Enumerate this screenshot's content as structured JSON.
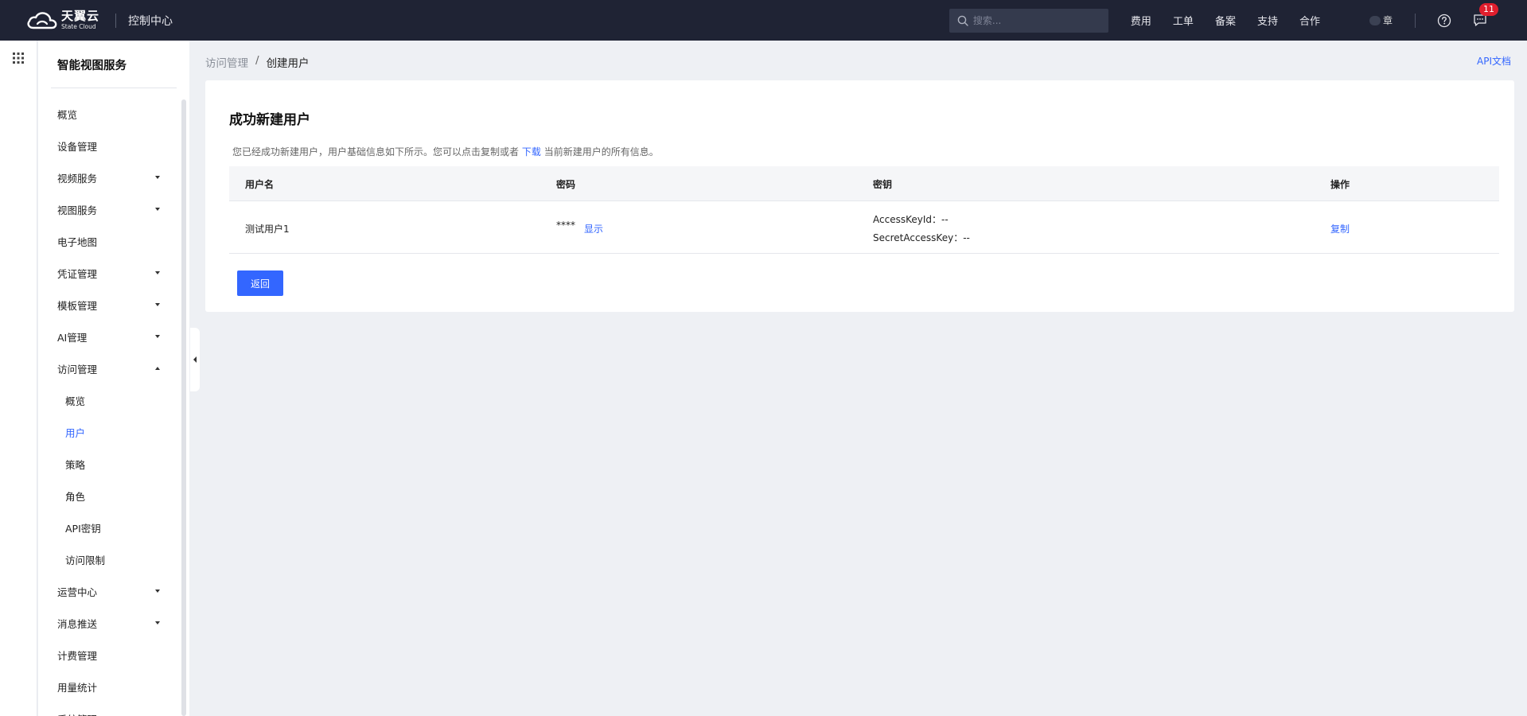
{
  "header": {
    "brand_cn": "天翼云",
    "brand_en": "State Cloud",
    "console_title": "控制中心",
    "search_placeholder": "搜索...",
    "nav": [
      "费用",
      "工单",
      "备案",
      "支持",
      "合作"
    ],
    "user_label": "章",
    "message_count": "11"
  },
  "sidebar": {
    "title": "智能视图服务",
    "items": [
      {
        "label": "概览",
        "sub": false,
        "caret": ""
      },
      {
        "label": "设备管理",
        "sub": false,
        "caret": ""
      },
      {
        "label": "视频服务",
        "sub": false,
        "caret": "down"
      },
      {
        "label": "视图服务",
        "sub": false,
        "caret": "down"
      },
      {
        "label": "电子地图",
        "sub": false,
        "caret": ""
      },
      {
        "label": "凭证管理",
        "sub": false,
        "caret": "down"
      },
      {
        "label": "模板管理",
        "sub": false,
        "caret": "down"
      },
      {
        "label": "AI管理",
        "sub": false,
        "caret": "down"
      },
      {
        "label": "访问管理",
        "sub": false,
        "caret": "up"
      },
      {
        "label": "概览",
        "sub": true,
        "caret": ""
      },
      {
        "label": "用户",
        "sub": true,
        "caret": "",
        "active": true
      },
      {
        "label": "策略",
        "sub": true,
        "caret": ""
      },
      {
        "label": "角色",
        "sub": true,
        "caret": ""
      },
      {
        "label": "API密钥",
        "sub": true,
        "caret": ""
      },
      {
        "label": "访问限制",
        "sub": true,
        "caret": ""
      },
      {
        "label": "运营中心",
        "sub": false,
        "caret": "down"
      },
      {
        "label": "消息推送",
        "sub": false,
        "caret": "down"
      },
      {
        "label": "计费管理",
        "sub": false,
        "caret": ""
      },
      {
        "label": "用量统计",
        "sub": false,
        "caret": ""
      },
      {
        "label": "系统管理",
        "sub": false,
        "caret": ""
      }
    ]
  },
  "breadcrumb": {
    "parent": "访问管理",
    "separator": "/",
    "current": "创建用户"
  },
  "api_doc": "API文档",
  "card": {
    "title": "成功新建用户",
    "desc_before": "您已经成功新建用户，用户基础信息如下所示。您可以点击复制或者",
    "desc_link": "下载",
    "desc_after": "当前新建用户的所有信息。",
    "columns": [
      "用户名",
      "密码",
      "密钥",
      "操作"
    ],
    "row": {
      "username": "测试用户1",
      "password_mask": "****",
      "show_label": "显示",
      "access_key": "AccessKeyId：--",
      "secret_key": "SecretAccessKey：--",
      "copy_label": "复制"
    },
    "back_label": "返回"
  },
  "colors": {
    "topbar": "#1f2334",
    "accent": "#3366ff",
    "badge": "#e01e2d"
  }
}
